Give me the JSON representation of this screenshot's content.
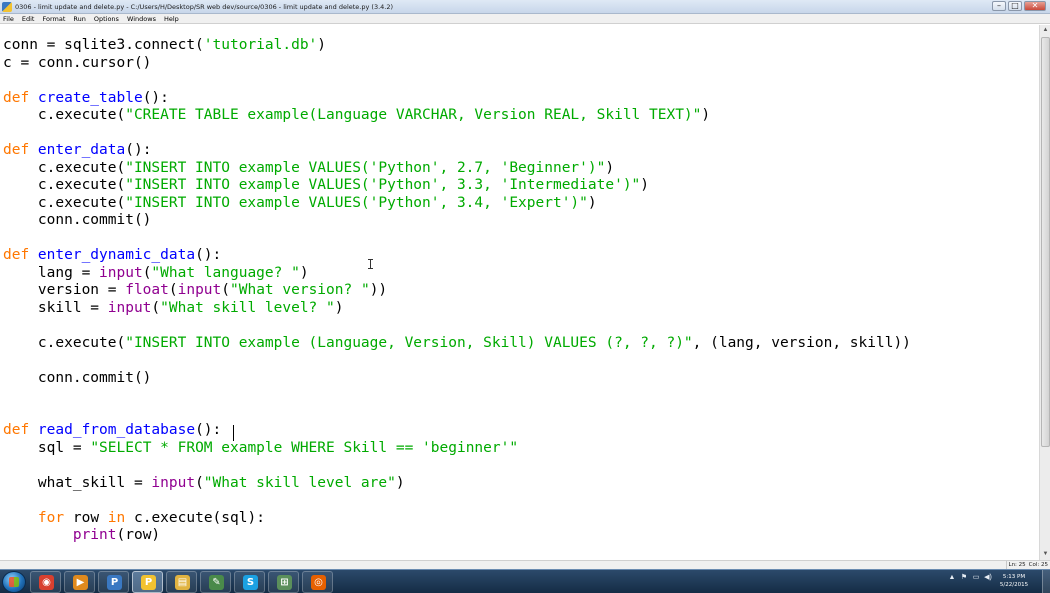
{
  "window": {
    "title": "0306 - limit update and delete.py - C:/Users/H/Desktop/SR web dev/source/0306 - limit update and delete.py (3.4.2)",
    "controls": {
      "minimize": "–",
      "maximize": "□",
      "close": "✕"
    }
  },
  "menu": [
    "File",
    "Edit",
    "Format",
    "Run",
    "Options",
    "Windows",
    "Help"
  ],
  "editor": {
    "lines": [
      [
        [
          "",
          "conn = sqlite3.connect("
        ],
        [
          "str",
          "'tutorial.db'"
        ],
        [
          "",
          ")"
        ]
      ],
      [
        [
          "",
          "c = conn.cursor()"
        ]
      ],
      [],
      [
        [
          "kw",
          "def "
        ],
        [
          "def",
          "create_table"
        ],
        [
          "",
          "():"
        ]
      ],
      [
        [
          "",
          "    c.execute("
        ],
        [
          "str",
          "\"CREATE TABLE example(Language VARCHAR, Version REAL, Skill TEXT)\""
        ],
        [
          "",
          ")"
        ]
      ],
      [],
      [
        [
          "kw",
          "def "
        ],
        [
          "def",
          "enter_data"
        ],
        [
          "",
          "():"
        ]
      ],
      [
        [
          "",
          "    c.execute("
        ],
        [
          "str",
          "\"INSERT INTO example VALUES('Python', 2.7, 'Beginner')\""
        ],
        [
          "",
          ")"
        ]
      ],
      [
        [
          "",
          "    c.execute("
        ],
        [
          "str",
          "\"INSERT INTO example VALUES('Python', 3.3, 'Intermediate')\""
        ],
        [
          "",
          ")"
        ]
      ],
      [
        [
          "",
          "    c.execute("
        ],
        [
          "str",
          "\"INSERT INTO example VALUES('Python', 3.4, 'Expert')\""
        ],
        [
          "",
          ")"
        ]
      ],
      [
        [
          "",
          "    conn.commit()"
        ]
      ],
      [],
      [
        [
          "kw",
          "def "
        ],
        [
          "def",
          "enter_dynamic_data"
        ],
        [
          "",
          "():"
        ]
      ],
      [
        [
          "",
          "    lang = "
        ],
        [
          "bi",
          "input"
        ],
        [
          "",
          "("
        ],
        [
          "str",
          "\"What language? \""
        ],
        [
          "",
          ")"
        ]
      ],
      [
        [
          "",
          "    version = "
        ],
        [
          "bi",
          "float"
        ],
        [
          "",
          "("
        ],
        [
          "bi",
          "input"
        ],
        [
          "",
          "("
        ],
        [
          "str",
          "\"What version? \""
        ],
        [
          "",
          "))"
        ]
      ],
      [
        [
          "",
          "    skill = "
        ],
        [
          "bi",
          "input"
        ],
        [
          "",
          "("
        ],
        [
          "str",
          "\"What skill level? \""
        ],
        [
          "",
          ")"
        ]
      ],
      [],
      [
        [
          "",
          "    c.execute("
        ],
        [
          "str",
          "\"INSERT INTO example (Language, Version, Skill) VALUES (?, ?, ?)\""
        ],
        [
          "",
          ", (lang, version, skill))"
        ]
      ],
      [],
      [
        [
          "",
          "    conn.commit()"
        ]
      ],
      [],
      [],
      [
        [
          "kw",
          "def "
        ],
        [
          "def",
          "read_from_database"
        ],
        [
          "",
          "():"
        ]
      ],
      [
        [
          "",
          "    sql = "
        ],
        [
          "str",
          "\"SELECT * FROM example WHERE Skill == 'beginner'\""
        ]
      ],
      [],
      [
        [
          "",
          "    what_skill = "
        ],
        [
          "bi",
          "input"
        ],
        [
          "",
          "("
        ],
        [
          "str",
          "\"What skill level are\""
        ],
        [
          "",
          ")"
        ]
      ],
      [],
      [
        [
          "",
          "    "
        ],
        [
          "kw",
          "for"
        ],
        [
          "",
          " row "
        ],
        [
          "kw",
          "in"
        ],
        [
          "",
          " c.execute(sql):"
        ]
      ],
      [
        [
          "",
          "        "
        ],
        [
          "bi",
          "print"
        ],
        [
          "",
          "(row)"
        ]
      ]
    ]
  },
  "status": {
    "line": "Ln: 25",
    "col": "Col: 25"
  },
  "taskbar": {
    "apps": [
      {
        "name": "chrome",
        "glyph": "◉",
        "color": "#d8402f"
      },
      {
        "name": "media-player",
        "glyph": "▶",
        "color": "#e08a1e"
      },
      {
        "name": "python-shell",
        "glyph": "P",
        "color": "#3a78c2"
      },
      {
        "name": "python-editor",
        "glyph": "P",
        "color": "#f2c230"
      },
      {
        "name": "file-explorer",
        "glyph": "▤",
        "color": "#e0b341"
      },
      {
        "name": "editor-app",
        "glyph": "✎",
        "color": "#4a8a4a"
      },
      {
        "name": "skype",
        "glyph": "S",
        "color": "#1ba1e2"
      },
      {
        "name": "network-app",
        "glyph": "⊞",
        "color": "#5b8f5b"
      },
      {
        "name": "firefox",
        "glyph": "◎",
        "color": "#e66000"
      }
    ],
    "tray": [
      "▲",
      "⚑",
      "▭",
      "◀)"
    ],
    "clock": {
      "time": "5:13 PM",
      "date": "5/22/2015"
    }
  }
}
